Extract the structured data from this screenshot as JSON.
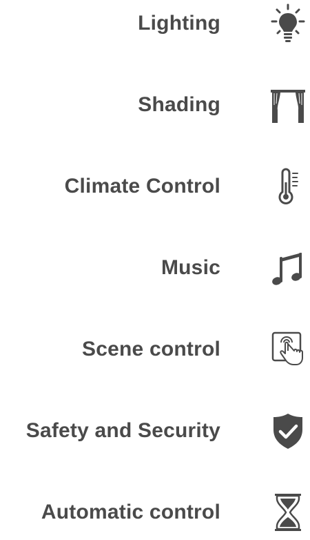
{
  "menu": {
    "items": [
      {
        "label": "Lighting",
        "icon": "lightbulb-icon"
      },
      {
        "label": "Shading",
        "icon": "curtain-icon"
      },
      {
        "label": "Climate Control",
        "icon": "thermometer-icon"
      },
      {
        "label": "Music",
        "icon": "music-note-icon"
      },
      {
        "label": "Scene control",
        "icon": "touch-panel-icon"
      },
      {
        "label": "Safety and Security",
        "icon": "shield-check-icon"
      },
      {
        "label": "Automatic control",
        "icon": "hourglass-icon"
      }
    ]
  },
  "colors": {
    "text": "#4a4a4a",
    "icon": "#4a4a4a",
    "background": "#ffffff"
  }
}
